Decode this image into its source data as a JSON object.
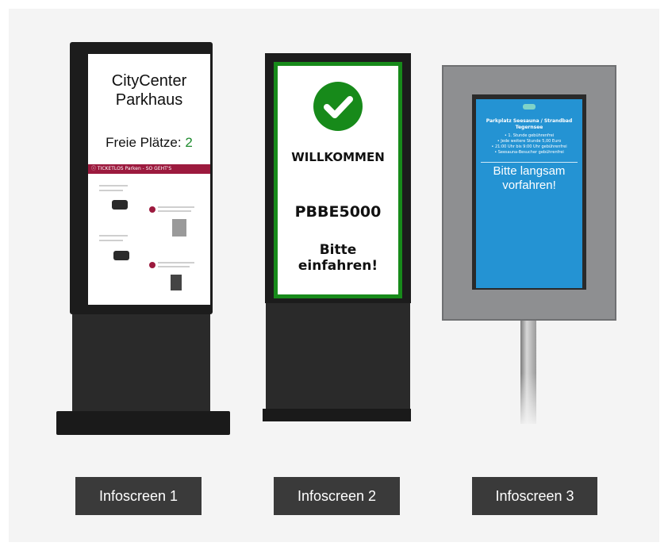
{
  "screen1": {
    "title_line1": "CityCenter",
    "title_line2": "Parkhaus",
    "free_label": "Freie Plätze:",
    "free_count": "2",
    "banner": "TICKETLOS Parken - SO GEHT'S"
  },
  "screen2": {
    "welcome": "WILLKOMMEN",
    "plate": "PBBE5000",
    "prompt_line1": "Bitte",
    "prompt_line2": "einfahren!"
  },
  "screen3": {
    "header_line1": "Parkplatz Seesauna / Strandbad",
    "header_line2": "Tegernsee",
    "bullets": [
      "• 1. Stunde gebührenfrei",
      "• Jede weitere Stunde 5,00 Euro",
      "• 21:00 Uhr bis 9:00 Uhr gebührenfrei",
      "• Seesauna-Besucher gebührenfrei"
    ],
    "message_line1": "Bitte langsam",
    "message_line2": "vorfahren!"
  },
  "labels": [
    "Infoscreen 1",
    "Infoscreen 2",
    "Infoscreen 3"
  ],
  "colors": {
    "accent_green": "#178a1a",
    "banner_red": "#9c1a3e",
    "screen_blue": "#2493d3",
    "label_bg": "#3a3a3a"
  }
}
